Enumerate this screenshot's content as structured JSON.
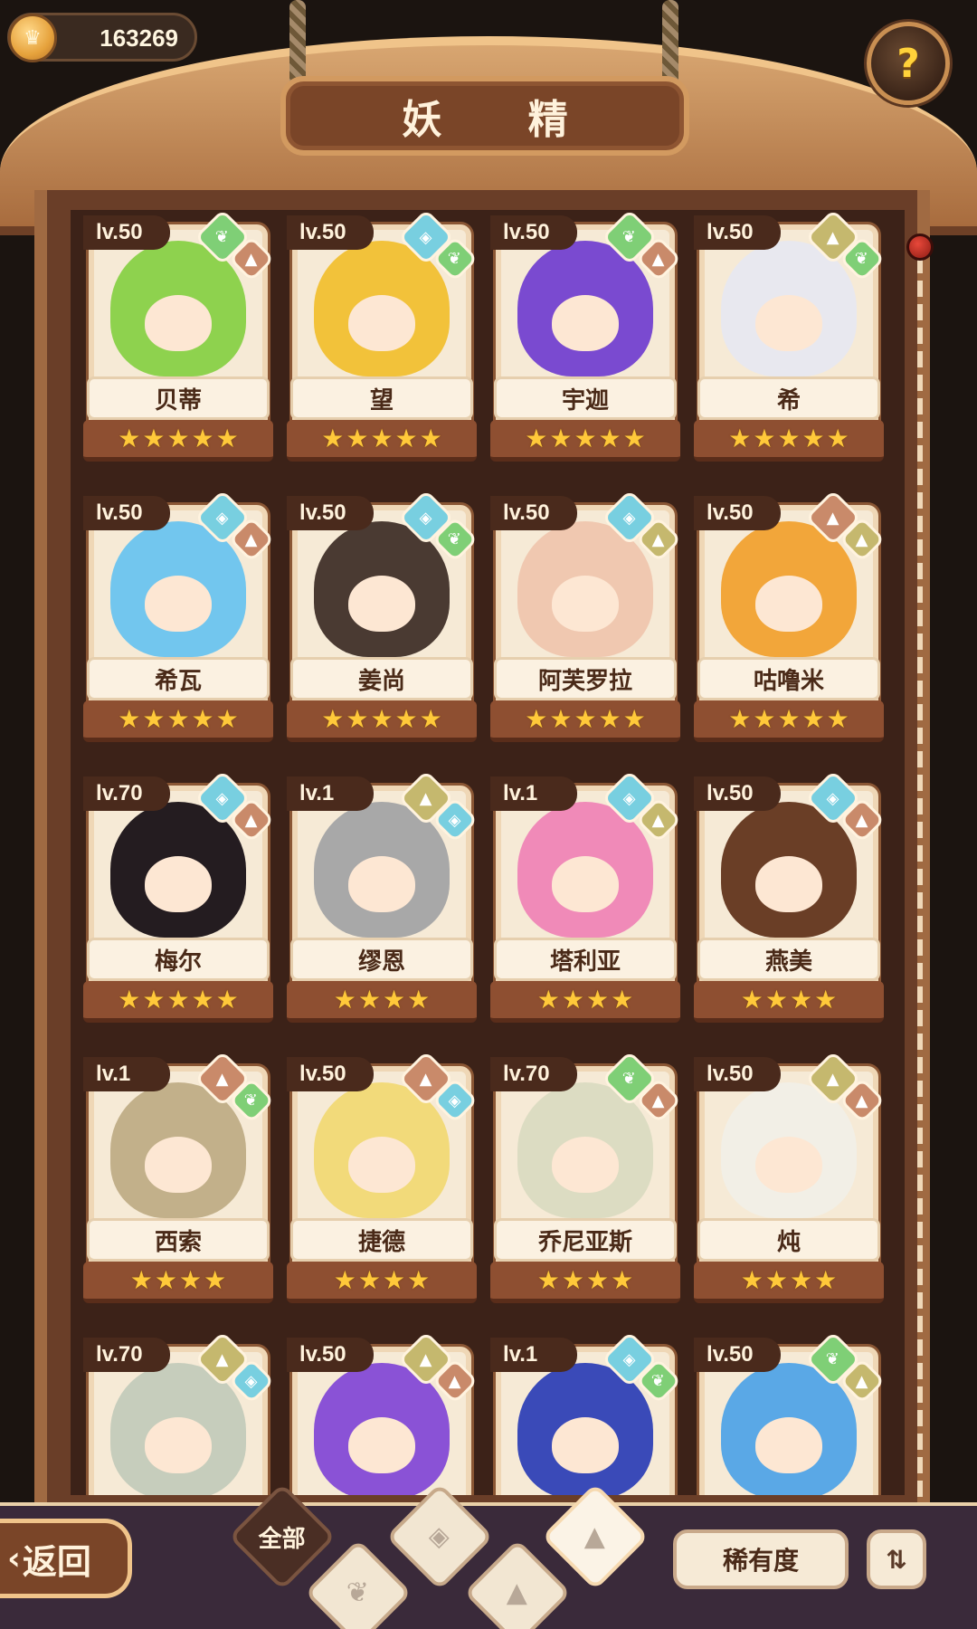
{
  "header": {
    "title": "妖 精",
    "currency_amount": "163269",
    "help_label": "?"
  },
  "colors": {
    "leaf": "#7fcf76",
    "water": "#78cfe0",
    "earth": "#c5b86e",
    "fire": "#c98a6a"
  },
  "fairies": [
    {
      "level": "lv.50",
      "name": "贝蒂",
      "stars": 5,
      "elements": [
        "leaf",
        "fire"
      ],
      "hair": "#8ed24e"
    },
    {
      "level": "lv.50",
      "name": "望",
      "stars": 5,
      "elements": [
        "water",
        "leaf"
      ],
      "hair": "#f2c23a"
    },
    {
      "level": "lv.50",
      "name": "宇迦",
      "stars": 5,
      "elements": [
        "leaf",
        "fire"
      ],
      "hair": "#7a4ad0"
    },
    {
      "level": "lv.50",
      "name": "希",
      "stars": 5,
      "elements": [
        "earth",
        "leaf"
      ],
      "hair": "#e8e8ef"
    },
    {
      "level": "lv.50",
      "name": "希瓦",
      "stars": 5,
      "elements": [
        "water",
        "fire"
      ],
      "hair": "#72c6ee"
    },
    {
      "level": "lv.50",
      "name": "姜尚",
      "stars": 5,
      "elements": [
        "water",
        "leaf"
      ],
      "hair": "#4a3a32"
    },
    {
      "level": "lv.50",
      "name": "阿芙罗拉",
      "stars": 5,
      "elements": [
        "water",
        "earth"
      ],
      "hair": "#f0c8b0"
    },
    {
      "level": "lv.50",
      "name": "咕噜米",
      "stars": 5,
      "elements": [
        "fire",
        "earth"
      ],
      "hair": "#f2a63a"
    },
    {
      "level": "lv.70",
      "name": "梅尔",
      "stars": 5,
      "elements": [
        "water",
        "fire"
      ],
      "hair": "#241c20"
    },
    {
      "level": "lv.1",
      "name": "缪恩",
      "stars": 4,
      "elements": [
        "earth",
        "water"
      ],
      "hair": "#a8a8a8"
    },
    {
      "level": "lv.1",
      "name": "塔利亚",
      "stars": 4,
      "elements": [
        "water",
        "earth"
      ],
      "hair": "#f08ab8"
    },
    {
      "level": "lv.50",
      "name": "燕美",
      "stars": 4,
      "elements": [
        "water",
        "fire"
      ],
      "hair": "#6a3e26"
    },
    {
      "level": "lv.1",
      "name": "西索",
      "stars": 4,
      "elements": [
        "fire",
        "leaf"
      ],
      "hair": "#c2b08a"
    },
    {
      "level": "lv.50",
      "name": "捷德",
      "stars": 4,
      "elements": [
        "fire",
        "water"
      ],
      "hair": "#f2da7a"
    },
    {
      "level": "lv.70",
      "name": "乔尼亚斯",
      "stars": 4,
      "elements": [
        "leaf",
        "fire"
      ],
      "hair": "#dcdcc2"
    },
    {
      "level": "lv.50",
      "name": "炖",
      "stars": 4,
      "elements": [
        "earth",
        "fire"
      ],
      "hair": "#f2efe6"
    },
    {
      "level": "lv.70",
      "name": "",
      "stars": 0,
      "elements": [
        "earth",
        "water"
      ],
      "hair": "#c6cdbc"
    },
    {
      "level": "lv.50",
      "name": "",
      "stars": 0,
      "elements": [
        "earth",
        "fire"
      ],
      "hair": "#8a52d6"
    },
    {
      "level": "lv.1",
      "name": "",
      "stars": 0,
      "elements": [
        "water",
        "leaf"
      ],
      "hair": "#3a4ab8"
    },
    {
      "level": "lv.50",
      "name": "",
      "stars": 0,
      "elements": [
        "leaf",
        "earth"
      ],
      "hair": "#5aa8e6"
    }
  ],
  "bottom": {
    "back_label": "返回",
    "filter_all_label": "全部",
    "sort_label": "稀有度",
    "order_icon": "sort-order-icon"
  }
}
